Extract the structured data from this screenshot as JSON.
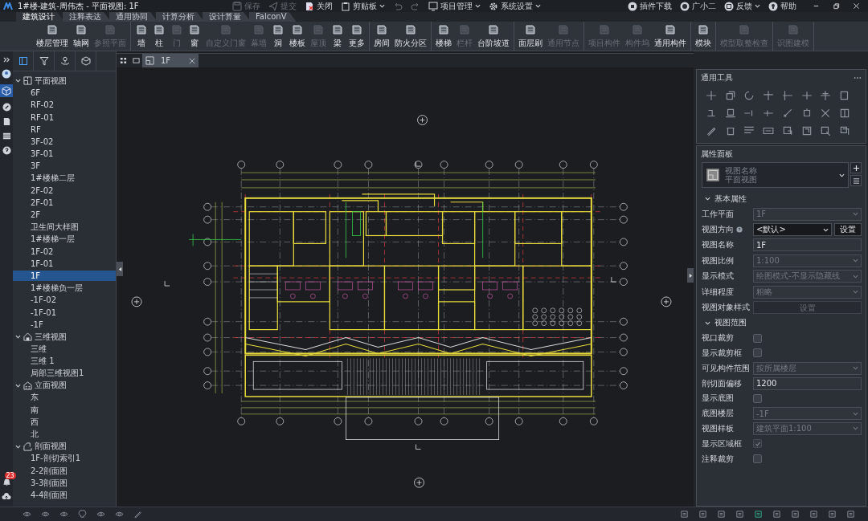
{
  "title_bar": {
    "title": "1#楼-建筑-周伟杰 - 平面视图: 1F",
    "actions": [
      {
        "kind": "save",
        "label": "保存",
        "disabled": true,
        "dropdown": false
      },
      {
        "kind": "submit",
        "label": "提交",
        "disabled": true,
        "dropdown": false
      },
      {
        "kind": "close",
        "label": "关闭",
        "disabled": false,
        "dropdown": false
      },
      {
        "kind": "clipboard",
        "label": "剪贴板",
        "disabled": false,
        "dropdown": true
      },
      {
        "kind": "undo",
        "disabled": true,
        "dropdown": false
      },
      {
        "kind": "redo",
        "disabled": true,
        "dropdown": false
      },
      {
        "kind": "project",
        "label": "项目管理",
        "disabled": false,
        "dropdown": true
      },
      {
        "kind": "settings",
        "label": "系统设置",
        "disabled": false,
        "dropdown": true
      }
    ],
    "right_actions": [
      {
        "kind": "plugin",
        "label": "插件下载",
        "dropdown": false
      },
      {
        "kind": "assistant",
        "label": "广小二",
        "dropdown": false
      },
      {
        "kind": "feedback",
        "label": "反馈",
        "dropdown": true
      },
      {
        "kind": "help",
        "label": "帮助",
        "dropdown": false
      }
    ]
  },
  "ribbon_tabs": [
    {
      "label": "建筑设计",
      "selected": true
    },
    {
      "label": "注释表达",
      "selected": false
    },
    {
      "label": "通用协同",
      "selected": false
    },
    {
      "label": "计算分析",
      "selected": false
    },
    {
      "label": "设计算量",
      "selected": false
    },
    {
      "label": "FalconV",
      "selected": false
    }
  ],
  "ribbon": [
    {
      "buttons": [
        {
          "label": "楼层管理",
          "disabled": false
        },
        {
          "label": "轴网",
          "disabled": false
        },
        {
          "label": "参照平面",
          "disabled": true
        }
      ]
    },
    {
      "buttons": [
        {
          "label": "墙",
          "disabled": false
        },
        {
          "label": "柱",
          "disabled": false
        },
        {
          "label": "门",
          "disabled": true
        },
        {
          "label": "窗",
          "disabled": false
        },
        {
          "label": "自定义门窗",
          "disabled": true
        },
        {
          "label": "幕墙",
          "disabled": true
        },
        {
          "label": "洞",
          "disabled": false
        },
        {
          "label": "楼板",
          "disabled": false
        },
        {
          "label": "屋顶",
          "disabled": true
        },
        {
          "label": "梁",
          "disabled": false
        },
        {
          "label": "更多",
          "disabled": false
        }
      ]
    },
    {
      "buttons": [
        {
          "label": "房间",
          "disabled": false
        },
        {
          "label": "防火分区",
          "disabled": false
        }
      ]
    },
    {
      "buttons": [
        {
          "label": "楼梯",
          "disabled": false
        },
        {
          "label": "栏杆",
          "disabled": true
        },
        {
          "label": "台阶坡道",
          "disabled": false
        }
      ]
    },
    {
      "buttons": [
        {
          "label": "面层刷",
          "disabled": false
        },
        {
          "label": "通用节点",
          "disabled": true
        }
      ]
    },
    {
      "buttons": [
        {
          "label": "项目构件",
          "disabled": true
        },
        {
          "label": "构件坞",
          "disabled": true
        },
        {
          "label": "通用构件",
          "disabled": false
        }
      ]
    },
    {
      "buttons": [
        {
          "label": "模块",
          "disabled": false
        }
      ]
    },
    {
      "buttons": [
        {
          "label": "模型取整检查",
          "disabled": true
        }
      ]
    },
    {
      "buttons": [
        {
          "label": "识图建模",
          "disabled": true
        }
      ]
    }
  ],
  "notifications": {
    "badge": "23"
  },
  "tree": [
    {
      "kind": "plan",
      "label": "平面视图",
      "expanded": true,
      "children": [
        {
          "label": "6F",
          "selected": false
        },
        {
          "label": "RF-02",
          "selected": false
        },
        {
          "label": "RF-01",
          "selected": false
        },
        {
          "label": "RF",
          "selected": false
        },
        {
          "label": "3F-02",
          "selected": false
        },
        {
          "label": "3F-01",
          "selected": false
        },
        {
          "label": "3F",
          "selected": false
        },
        {
          "label": "1#楼梯二层",
          "selected": false
        },
        {
          "label": "2F-02",
          "selected": false
        },
        {
          "label": "2F-01",
          "selected": false
        },
        {
          "label": "2F",
          "selected": false
        },
        {
          "label": "卫生间大样图",
          "selected": false
        },
        {
          "label": "1#楼梯一层",
          "selected": false
        },
        {
          "label": "1F-02",
          "selected": false
        },
        {
          "label": "1F-01",
          "selected": false
        },
        {
          "label": "1F",
          "selected": true
        },
        {
          "label": "1#楼梯负一层",
          "selected": false
        },
        {
          "label": "-1F-02",
          "selected": false
        },
        {
          "label": "-1F-01",
          "selected": false
        },
        {
          "label": "-1F",
          "selected": false
        }
      ]
    },
    {
      "kind": "model",
      "label": "三维视图",
      "expanded": true,
      "children": [
        {
          "label": "三维",
          "selected": false
        },
        {
          "label": "三维 1",
          "selected": false
        },
        {
          "label": "局部三维视图1",
          "selected": false
        }
      ]
    },
    {
      "kind": "elevation",
      "label": "立面视图",
      "expanded": true,
      "children": [
        {
          "label": "东",
          "selected": false
        },
        {
          "label": "南",
          "selected": false
        },
        {
          "label": "西",
          "selected": false
        },
        {
          "label": "北",
          "selected": false
        }
      ]
    },
    {
      "kind": "section",
      "label": "剖面视图",
      "expanded": true,
      "children": [
        {
          "label": "1F-剖切索引1",
          "selected": false
        },
        {
          "label": "2-2剖面图",
          "selected": false
        },
        {
          "label": "3-3剖面图",
          "selected": false
        },
        {
          "label": "4-4剖面图",
          "selected": false
        }
      ]
    }
  ],
  "document_tabs": [
    {
      "label": "1F",
      "selected": true
    }
  ],
  "tools_panel": {
    "title": "通用工具"
  },
  "properties_panel": {
    "title": "属性面板",
    "view_name_label": "视图名称",
    "view_type": "平面视图",
    "sections": [
      {
        "title": "基本属性",
        "expanded": true,
        "rows": [
          {
            "label": "工作平面",
            "kind": "select",
            "value": "1F",
            "disabled": true,
            "help": false
          },
          {
            "label": "视图方向",
            "kind": "select",
            "value": "<默认>",
            "disabled": false,
            "help": true,
            "action": "设置"
          },
          {
            "label": "视图名称",
            "kind": "input",
            "value": "1F",
            "disabled": false,
            "help": false
          },
          {
            "label": "视图比例",
            "kind": "select",
            "value": "1:100",
            "disabled": true,
            "help": false
          },
          {
            "label": "显示模式",
            "kind": "select",
            "value": "绘图模式-不显示隐藏线",
            "disabled": true,
            "help": false
          },
          {
            "label": "详细程度",
            "kind": "select",
            "value": "粗略",
            "disabled": true,
            "help": false
          },
          {
            "label": "视图对象样式",
            "kind": "button",
            "value": "设置",
            "disabled": true,
            "help": false
          }
        ]
      },
      {
        "title": "视图范围",
        "expanded": true,
        "rows": [
          {
            "label": "视口裁剪",
            "kind": "checkbox",
            "checked": false,
            "disabled": false,
            "help": false
          },
          {
            "label": "显示裁剪框",
            "kind": "checkbox",
            "checked": false,
            "disabled": false,
            "help": false
          },
          {
            "label": "可见构件范围",
            "kind": "select",
            "value": "按所属楼层",
            "disabled": true,
            "help": false
          },
          {
            "label": "剖切面偏移",
            "kind": "input",
            "value": "1200",
            "disabled": false,
            "help": false
          },
          {
            "label": "显示底图",
            "kind": "checkbox",
            "checked": false,
            "disabled": false,
            "help": false
          },
          {
            "label": "底图楼层",
            "kind": "select",
            "value": "-1F",
            "disabled": true,
            "help": false
          },
          {
            "label": "视图样板",
            "kind": "select",
            "value": "建筑平面1:100",
            "disabled": true,
            "help": false
          },
          {
            "label": "显示区域框",
            "kind": "checkbox",
            "checked": true,
            "disabled": true,
            "help": false
          },
          {
            "label": "注释裁剪",
            "kind": "checkbox",
            "checked": false,
            "disabled": false,
            "help": false
          }
        ]
      }
    ]
  }
}
